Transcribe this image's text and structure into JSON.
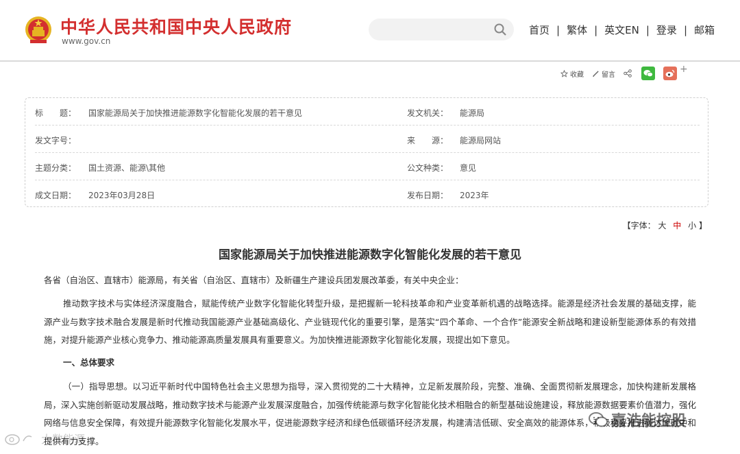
{
  "header": {
    "title": "中华人民共和国中央人民政府",
    "url": "www.gov.cn",
    "search_placeholder": "",
    "nav": [
      "首页",
      "繁体",
      "英文EN",
      "登录",
      "邮箱"
    ]
  },
  "toolbar": {
    "favorite": "收藏",
    "comment": "留言",
    "more": "+"
  },
  "info": {
    "rows": [
      {
        "label1": "标　　题：",
        "value1": "国家能源局关于加快推进能源数字化智能化发展的若干意见",
        "label2": "发文机关：",
        "value2": "能源局"
      },
      {
        "label1": "发文字号：",
        "value1": "",
        "label2": "来　　源：",
        "value2": "能源局网站"
      },
      {
        "label1": "主题分类：",
        "value1": "国土资源、能源\\其他",
        "label2": "公文种类：",
        "value2": "意见"
      },
      {
        "label1": "成文日期：",
        "value1": "2023年03月28日",
        "label2": "发布日期：",
        "value2": "2023年"
      }
    ]
  },
  "fontsize": {
    "prefix": "【字体：",
    "large": "大",
    "medium": "中",
    "small": "小",
    "suffix": "】"
  },
  "article": {
    "title": "国家能源局关于加快推进能源数字化智能化发展的若干意见",
    "salutation": "各省（自治区、直辖市）能源局，有关省（自治区、直辖市）及新疆生产建设兵团发展改革委，有关中央企业：",
    "p1": "推动数字技术与实体经济深度融合，赋能传统产业数字化智能化转型升级，是把握新一轮科技革命和产业变革新机遇的战略选择。能源是经济社会发展的基础支撑，能源产业与数字技术融合发展是新时代推动我国能源产业基础高级化、产业链现代化的重要引擎，是落实“四个革命、一个合作”能源安全新战略和建设新型能源体系的有效措施，对提升能源产业核心竞争力、推动能源高质量发展具有重要意义。为加快推进能源数字化智能化发展，现提出如下意见。",
    "section1": "一、总体要求",
    "p2": "（一）指导思想。以习近平新时代中国特色社会主义思想为指导，深入贯彻党的二十大精神，立足新发展阶段，完整、准确、全面贯彻新发展理念，加快构建新发展格局，深入实施创新驱动发展战略，推动数字技术与能源产业发展深度融合，加强传统能源与数字化智能化技术相融合的新型基础设施建设，释放能源数据要素价值潜力，强化网络与信息安全保障，有效提升能源数字化智能化发展水平，促进能源数字经济和绿色低碳循环经济发展，构建清洁低碳、安全高效的能源体系，积极稳妥推进碳达峰碳中和提供有力支撑。"
  },
  "watermark": {
    "right": "嘉浩能控股",
    "left": "大数能源"
  },
  "colors": {
    "brand_red": "#d32f2f",
    "wechat_green": "#3fb93f",
    "weibo_red": "#e5705a"
  }
}
